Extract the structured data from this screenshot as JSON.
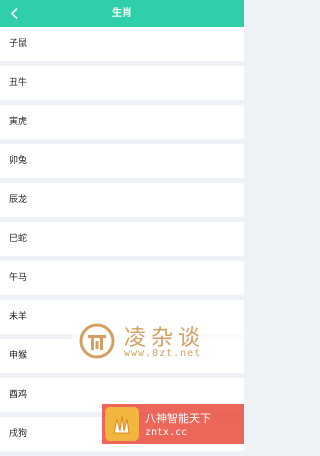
{
  "header": {
    "title": "生肖",
    "back_icon": "chevron-left-icon"
  },
  "items": [
    {
      "label": "子鼠"
    },
    {
      "label": "丑牛"
    },
    {
      "label": "寅虎"
    },
    {
      "label": "卯兔"
    },
    {
      "label": "辰龙"
    },
    {
      "label": "巳蛇"
    },
    {
      "label": "午马"
    },
    {
      "label": "未羊"
    },
    {
      "label": "申猴"
    },
    {
      "label": "酉鸡"
    },
    {
      "label": "戌狗"
    }
  ],
  "watermark_1": {
    "text": "凌杂谈",
    "url": "www.0zt.net"
  },
  "watermark_2": {
    "text": "八神智能天下",
    "url": "zntx.cc"
  },
  "colors": {
    "accent": "#2ecfa9",
    "background": "#eef1f6",
    "item_bg": "#ffffff"
  }
}
